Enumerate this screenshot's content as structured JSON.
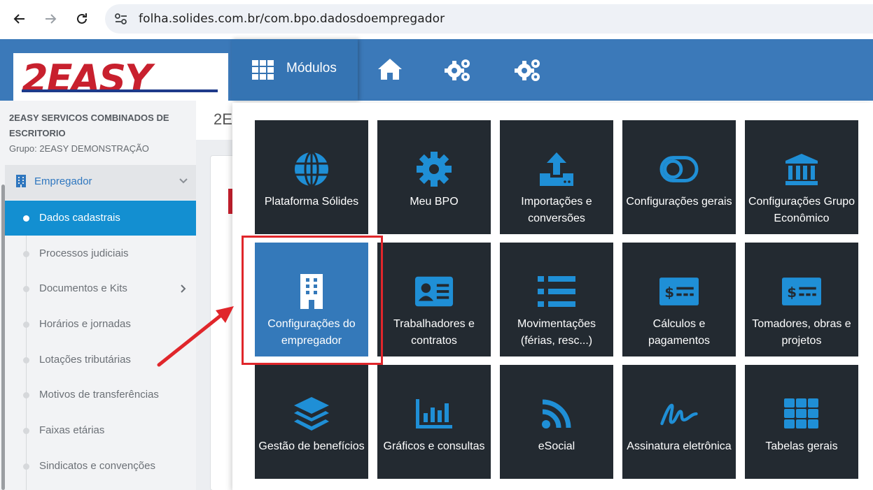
{
  "browser": {
    "url": "folha.solides.com.br/com.bpo.dadosdoempregador"
  },
  "header": {
    "logo_text": "2EASY",
    "modules_label": "Módulos",
    "colors": {
      "header": "#3b79b9",
      "tile": "#232a31",
      "tile_highlight": "#3479ba",
      "icon": "#1f8fd6",
      "active_menu": "#138fd1"
    }
  },
  "sidebar": {
    "company": "2EASY SERVICOS COMBINADOS DE ESCRITORIO",
    "group": "Grupo: 2EASY DEMONSTRAÇÃO",
    "section": "Empregador",
    "items": [
      {
        "label": "Dados cadastrais"
      },
      {
        "label": "Processos judiciais"
      },
      {
        "label": "Documentos e Kits"
      },
      {
        "label": "Horários e jornadas"
      },
      {
        "label": "Lotações tributárias"
      },
      {
        "label": "Motivos de transferências"
      },
      {
        "label": "Faixas etárias"
      },
      {
        "label": "Sindicatos e convenções"
      }
    ]
  },
  "content": {
    "title_fragment": "2E"
  },
  "modules": {
    "tiles": [
      {
        "label": "Plataforma Sólides",
        "icon": "globe-icon"
      },
      {
        "label": "Meu BPO",
        "icon": "gear-icon"
      },
      {
        "label": "Importações e conversões",
        "icon": "upload-icon"
      },
      {
        "label": "Configurações gerais",
        "icon": "toggle-icon"
      },
      {
        "label": "Configurações Grupo Econômico",
        "icon": "bank-icon"
      },
      {
        "label": "Configurações do empregador",
        "icon": "building-icon"
      },
      {
        "label": "Trabalhadores e contratos",
        "icon": "id-card-icon"
      },
      {
        "label": "Movimentações (férias, resc...)",
        "icon": "list-icon"
      },
      {
        "label": "Cálculos e pagamentos",
        "icon": "money-check-icon"
      },
      {
        "label": "Tomadores, obras e projetos",
        "icon": "money-check-icon"
      },
      {
        "label": "Gestão de benefícios",
        "icon": "layers-icon"
      },
      {
        "label": "Gráficos e consultas",
        "icon": "bar-chart-icon"
      },
      {
        "label": "eSocial",
        "icon": "rss-icon"
      },
      {
        "label": "Assinatura eletrônica",
        "icon": "signature-icon"
      },
      {
        "label": "Tabelas gerais",
        "icon": "grid-icon"
      }
    ]
  }
}
